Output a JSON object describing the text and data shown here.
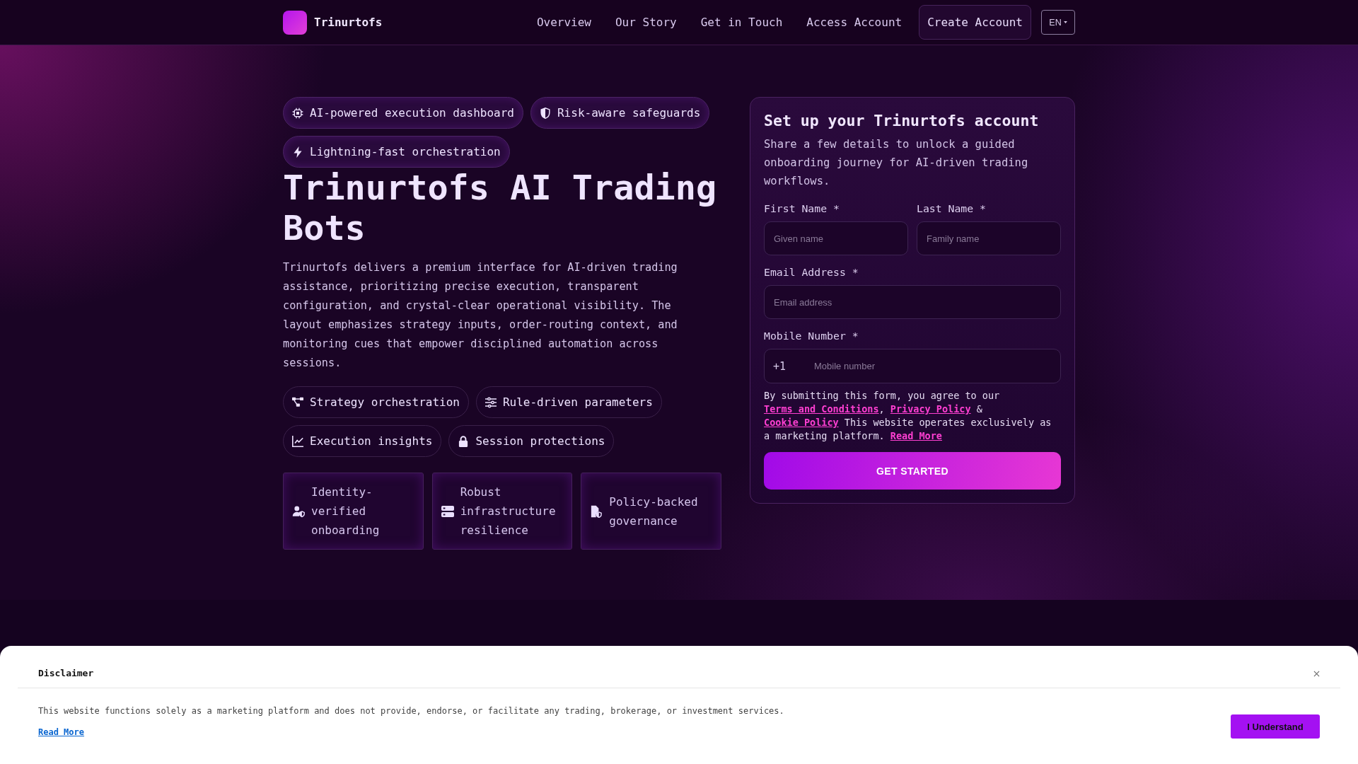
{
  "header": {
    "brand": "Trinurtofs",
    "nav": [
      "Overview",
      "Our Story",
      "Get in Touch",
      "Access Account"
    ],
    "cta": "Create Account",
    "language": "EN"
  },
  "hero": {
    "badges": [
      "AI-powered execution dashboard",
      "Risk-aware safeguards",
      "Lightning-fast orchestration"
    ],
    "title": "Trinurtofs AI Trading Bots",
    "description": "Trinurtofs delivers a premium interface for AI-driven trading assistance, prioritizing precise execution, transparent configuration, and crystal-clear operational visibility. The layout emphasizes strategy inputs, order-routing context, and monitoring cues that empower disciplined automation across sessions.",
    "features": [
      "Strategy orchestration",
      "Rule-driven parameters",
      "Execution insights",
      "Session protections"
    ],
    "cards": [
      "Identity-verified onboarding",
      "Robust infrastructure resilience",
      "Policy-backed governance"
    ]
  },
  "signup": {
    "title": "Set up your Trinurtofs account",
    "subtitle": "Share a few details to unlock a guided onboarding journey for AI-driven trading workflows.",
    "name_fields": [
      {
        "label": "First Name *",
        "placeholder": "Given name"
      },
      {
        "label": "Last Name *",
        "placeholder": "Family name"
      }
    ],
    "email": {
      "label": "Email Address *",
      "placeholder": "Email address"
    },
    "mobile": {
      "label": "Mobile Number *",
      "prefix": "+1",
      "placeholder": "Mobile number"
    },
    "consent": [
      {
        "kind": "text",
        "text": "By submitting this form, you agree to our "
      },
      {
        "kind": "link",
        "text": "Terms and Conditions"
      },
      {
        "kind": "text",
        "text": ", "
      },
      {
        "kind": "link",
        "text": "Privacy Policy"
      },
      {
        "kind": "text",
        "text": " & "
      },
      {
        "kind": "link",
        "text": "Cookie Policy"
      },
      {
        "kind": "text",
        "text": " This website operates exclusively as a marketing platform. "
      },
      {
        "kind": "link",
        "text": "Read More"
      }
    ],
    "submit": "GET STARTED"
  },
  "disclaimer": {
    "title": "Disclaimer",
    "text": "This website functions solely as a marketing platform and does not provide, endorse, or facilitate any trading, brokerage, or investment services.",
    "link": "Read More",
    "button": "I Understand"
  }
}
